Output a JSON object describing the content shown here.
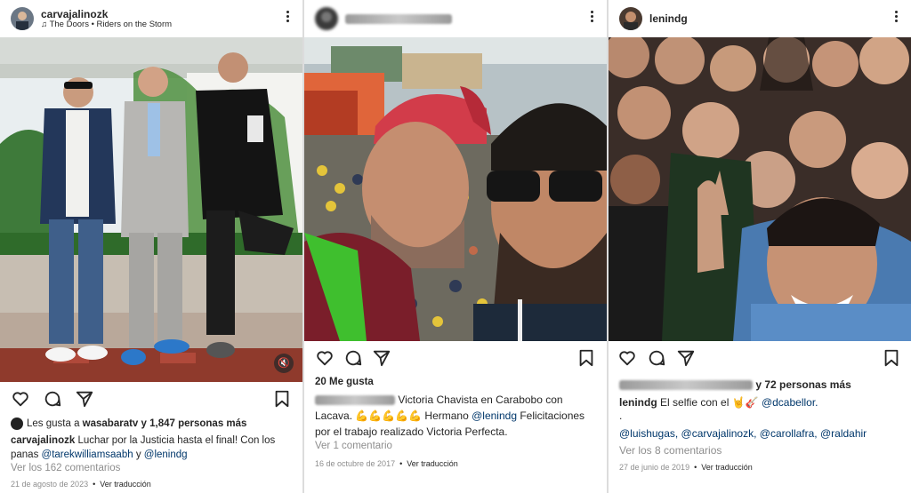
{
  "posts": [
    {
      "username": "carvajalinozk",
      "music": "♫ The Doors • Riders on the Storm",
      "likes_prefix": "Les gusta a",
      "liked_by": "wasabaratv",
      "likes_suffix": "y 1,847 personas más",
      "caption_user": "carvajalinozk",
      "caption_text": "Luchar por la Justicia hasta el final! Con los panas",
      "caption_mention1": "@tarekwilliamsaabh",
      "caption_and": "y",
      "caption_mention2": "@lenindg",
      "comments_link": "Ver los 162 comentarios",
      "date": "21 de agosto de 2023",
      "translate": "Ver traducción",
      "mute_icon": "🔇"
    },
    {
      "likes": "20 Me gusta",
      "caption_text1": "Victoria Chavista en Carabobo con Lacava. 💪💪💪💪💪 Hermano",
      "caption_mention": "@lenindg",
      "caption_text2": "Felicitaciones por el trabajo realizado  Victoria Perfecta.",
      "comments_link": "Ver 1 comentario",
      "date": "16 de octubre de 2017",
      "translate": "Ver traducción"
    },
    {
      "username": "lenindg",
      "likes_suffix": "y 72 personas más",
      "caption_user": "lenindg",
      "caption_text": "El selfie con el 🤘🎸",
      "caption_mention": "@dcabellor.",
      "caption_dot": ".",
      "mentions": "@luishugas, @carvajalinozk, @carollafra, @raldahir",
      "comments_link": "Ver los 8 comentarios",
      "date": "27 de junio de 2019",
      "translate": "Ver traducción"
    }
  ],
  "icons": [
    "heart-icon",
    "comment-icon",
    "share-icon",
    "bookmark-icon",
    "more-options-icon",
    "music-note-icon",
    "mute-icon"
  ]
}
